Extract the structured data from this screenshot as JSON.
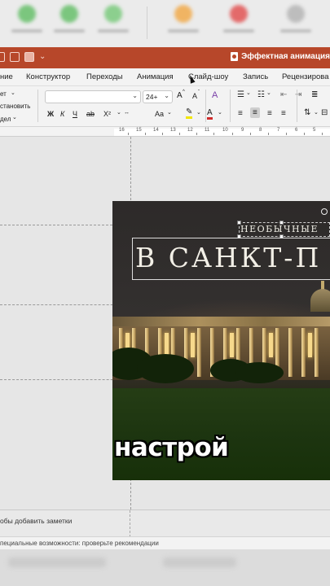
{
  "title_bar": {
    "doc_title": "Эффектная анимация"
  },
  "menu": {
    "tabs": [
      "ние",
      "Конструктор",
      "Переходы",
      "Анимация",
      "Слайд-шоу",
      "Запись",
      "Рецензирова"
    ]
  },
  "ribbon": {
    "left_items": [
      "ет",
      "становить",
      "дел"
    ],
    "font_name": "",
    "font_size": "24+",
    "grow_font": "A",
    "shrink_font": "A",
    "bold": "Ж",
    "italic": "К",
    "underline": "Ч",
    "strikethrough": "ab",
    "superscript": "X²",
    "change_case": "Aa",
    "font_color": "A",
    "clear_format": "A"
  },
  "ruler": {
    "numbers": [
      "16",
      "15",
      "14",
      "13",
      "12",
      "11",
      "10",
      "9",
      "8",
      "7",
      "6",
      "5"
    ]
  },
  "slide": {
    "small_title": "НЕОБЫЧНЫЕ",
    "big_title": "В САНКТ-П"
  },
  "video_subtitle": "настрой",
  "notes": {
    "placeholder": "обы добавить заметки"
  },
  "status_bar": {
    "accessibility": "пециальные возможности: проверьте рекомендации"
  },
  "colors": {
    "titlebar": "#b7472a",
    "ribbon_bg": "#f3f3f3",
    "canvas_bg": "#e6e6e6"
  }
}
